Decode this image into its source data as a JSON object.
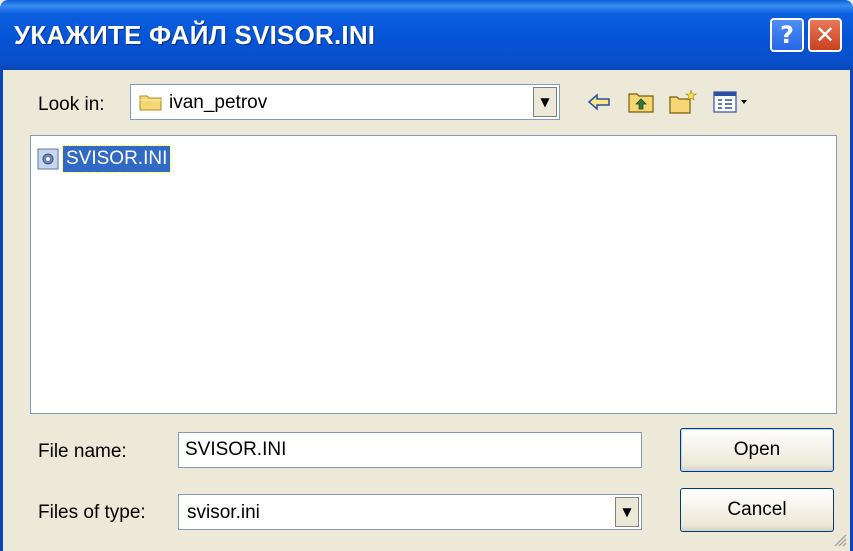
{
  "window": {
    "title": "УКАЖИТЕ ФАЙЛ SVISOR.INI",
    "help_label": "?",
    "close_label": "✕"
  },
  "look_in": {
    "label": "Look in:",
    "value": "ivan_petrov",
    "arrow": "▼"
  },
  "toolbar": {
    "icons": [
      "back-icon",
      "up-folder-icon",
      "new-folder-icon",
      "view-menu-icon"
    ]
  },
  "files": [
    {
      "name": "SVISOR.INI",
      "selected": true
    }
  ],
  "file_name": {
    "label": "File name:",
    "value": "SVISOR.INI"
  },
  "file_type": {
    "label": "Files of type:",
    "value": "svisor.ini",
    "arrow": "▼"
  },
  "buttons": {
    "open": "Open",
    "cancel": "Cancel"
  },
  "colors": {
    "title_bar": "#0553d4",
    "selection": "#316ac5",
    "dialog_bg": "#ece9d8"
  }
}
